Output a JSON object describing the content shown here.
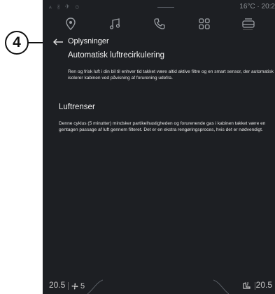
{
  "callout": {
    "number": "4"
  },
  "status_bar": {
    "left_symbols": "ⲁ ∦ ✈ ⊙",
    "info": "16°C · 20:2"
  },
  "nav": {
    "icons": [
      "location-pin-icon",
      "music-note-icon",
      "phone-icon",
      "apps-grid-icon",
      "car-icon"
    ],
    "active": "car-icon"
  },
  "page": {
    "title": "Oplysninger",
    "back_icon": "back-arrow-icon"
  },
  "sections": [
    {
      "title": "Automatisk luftrecirkulering",
      "body": "Ren og frisk luft i din bil til enhver tid takket være altid aktive filtre og en smart sensor, der automatisk isolerer kabinen ved påvisning af forurening udefra."
    },
    {
      "title": "Luftrenser",
      "body": "Denne cyklus (5 minutter) mindsker partikelhastigheden og forurenende gas i kabinen takket være en gentagen passage af luft gennem filteret. Det er en ekstra rengøringsproces, hvis det er nødvendigt."
    }
  ],
  "climate": {
    "temp_left": "20.5",
    "fan_level": "5",
    "temp_right": "20.5",
    "fan_icon": "fan-icon",
    "seat_icon": "seat-heat-icon"
  },
  "colors": {
    "screen_bg": "#1d1f23",
    "text": "#f2f2f2",
    "muted": "#8d9196"
  }
}
